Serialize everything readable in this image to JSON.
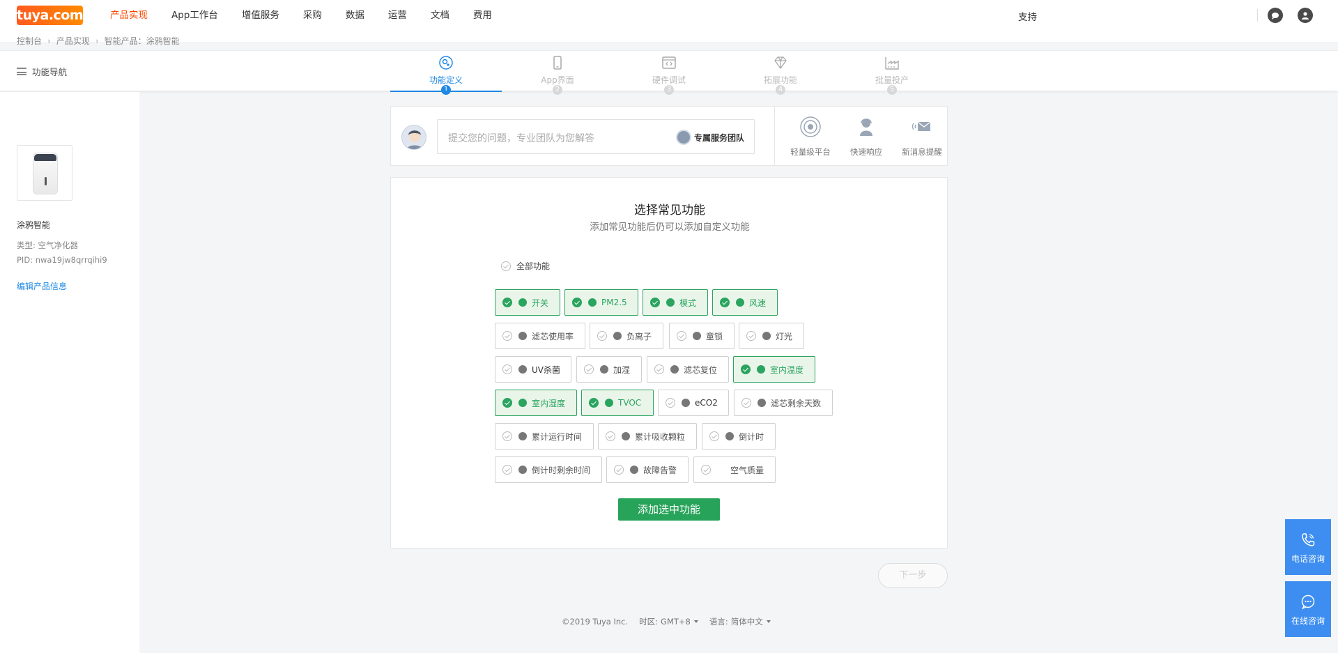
{
  "logo": "tuya.com",
  "nav": {
    "items": [
      "产品实现",
      "App工作台",
      "增值服务",
      "采购",
      "数据",
      "运营",
      "文档",
      "费用"
    ],
    "active_index": 0,
    "support": "支持"
  },
  "breadcrumb": [
    "控制台",
    "产品实现",
    "智能产品：涂鸦智能"
  ],
  "function_nav": "功能导航",
  "steps": [
    {
      "label": "功能定义",
      "num": "1",
      "icon": "gear-icon"
    },
    {
      "label": "App界面",
      "num": "2",
      "icon": "phone-icon"
    },
    {
      "label": "硬件调试",
      "num": "3",
      "icon": "code-icon"
    },
    {
      "label": "拓展功能",
      "num": "4",
      "icon": "diamond-icon"
    },
    {
      "label": "批量投产",
      "num": "5",
      "icon": "factory-icon"
    }
  ],
  "product": {
    "name": "涂鸦智能",
    "type": "类型: 空气净化器",
    "pid": "PID: nwa19jw8qrrqihi9",
    "edit": "编辑产品信息"
  },
  "help": {
    "placeholder": "提交您的问题，专业团队为您解答",
    "team": "专属服务团队",
    "features": [
      "轻量级平台",
      "快速响应",
      "新消息提醒"
    ]
  },
  "card": {
    "title": "选择常见功能",
    "subtitle": "添加常见功能后仍可以添加自定义功能",
    "all_label": "全部功能",
    "functions": [
      {
        "label": "开关",
        "selected": true,
        "icon": "power-icon"
      },
      {
        "label": "PM2.5",
        "selected": true,
        "icon": "particles-icon"
      },
      {
        "label": "模式",
        "selected": true,
        "icon": "grid-icon"
      },
      {
        "label": "风速",
        "selected": true,
        "icon": "fan-icon"
      },
      {
        "label": "滤芯使用率",
        "selected": false,
        "icon": "filter-icon"
      },
      {
        "label": "负离子",
        "selected": false,
        "icon": "ion-icon"
      },
      {
        "label": "童锁",
        "selected": false,
        "icon": "lock-icon"
      },
      {
        "label": "灯光",
        "selected": false,
        "icon": "light-icon"
      },
      {
        "label": "UV杀菌",
        "selected": false,
        "icon": "uv-icon"
      },
      {
        "label": "加湿",
        "selected": false,
        "icon": "humidify-icon"
      },
      {
        "label": "滤芯复位",
        "selected": false,
        "icon": "reset-icon"
      },
      {
        "label": "室内温度",
        "selected": true,
        "icon": "thermometer-icon"
      },
      {
        "label": "室内湿度",
        "selected": true,
        "icon": "droplet-icon"
      },
      {
        "label": "TVOC",
        "selected": true,
        "icon": "tvoc-icon"
      },
      {
        "label": "eCO2",
        "selected": false,
        "icon": "co2-icon"
      },
      {
        "label": "滤芯剩余天数",
        "selected": false,
        "icon": "days-icon"
      },
      {
        "label": "累计运行时间",
        "selected": false,
        "icon": "clock-icon"
      },
      {
        "label": "累计吸收颗粒",
        "selected": false,
        "icon": "absorb-icon"
      },
      {
        "label": "倒计时",
        "selected": false,
        "icon": "timer-icon"
      },
      {
        "label": "倒计时剩余时间",
        "selected": false,
        "icon": "timer-remaining-icon"
      },
      {
        "label": "故障告警",
        "selected": false,
        "icon": "alert-icon"
      },
      {
        "label": "空气质量",
        "selected": false,
        "icon": "air-quality-icon"
      }
    ],
    "add_button": "添加选中功能"
  },
  "next_button": "下一步",
  "footer": {
    "copyright": "©2019 Tuya Inc.",
    "timezone_label": "时区:",
    "timezone": "GMT+8",
    "language_label": "语言:",
    "language": "简体中文"
  },
  "float": {
    "phone": "电话咨询",
    "online": "在线咨询"
  },
  "colors": {
    "brand": "#ff4800",
    "accent": "#1e88e5",
    "selected_green": "#2aa45e",
    "float_blue": "#3d8ef0"
  }
}
